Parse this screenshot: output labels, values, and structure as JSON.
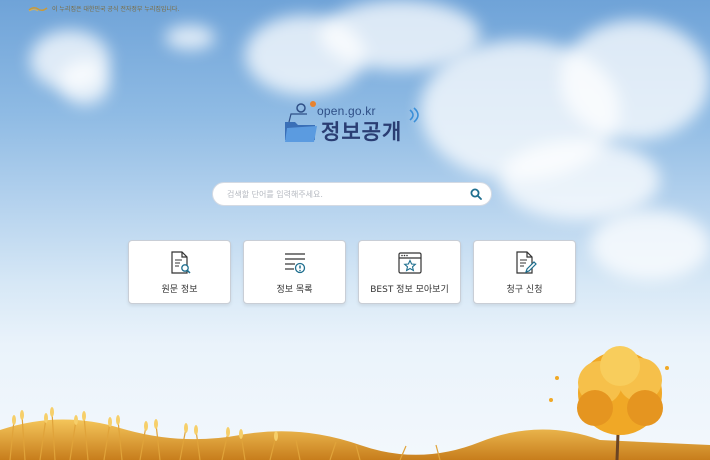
{
  "notice": {
    "text": "이 누리집은 대한민국 공식 전자정부 누리집입니다."
  },
  "logo": {
    "url": "open.go.kr",
    "name": "정보공개"
  },
  "search": {
    "placeholder": "검색할 단어를 입력해주세요."
  },
  "menu": [
    {
      "label": "원문 정보",
      "icon": "document-search-icon"
    },
    {
      "label": "정보 목록",
      "icon": "list-info-icon"
    },
    {
      "label": "BEST 정보 모아보기",
      "icon": "browser-star-icon"
    },
    {
      "label": "청구 신청",
      "icon": "document-edit-icon"
    }
  ],
  "colors": {
    "accent": "#2a3d73",
    "search_icon": "#1f6f8f",
    "icon_stroke": "#333333"
  }
}
